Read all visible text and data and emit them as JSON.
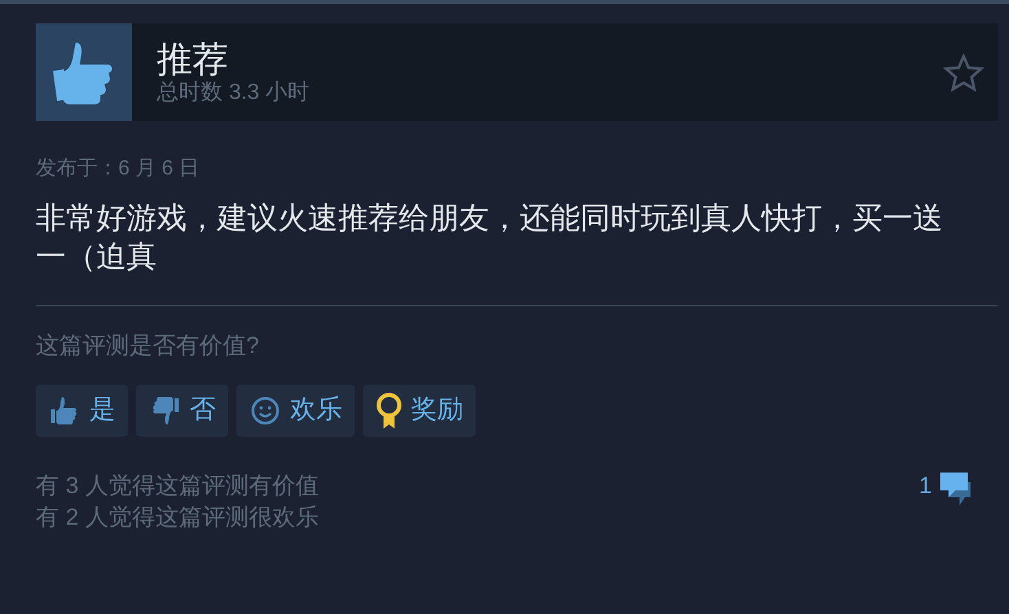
{
  "review": {
    "verdict": {
      "kind": "up",
      "label": "推荐"
    },
    "playtime": "总时数 3.3 小时",
    "favorited": false,
    "posted": "发布于：6 月 6 日",
    "body": "非常好游戏，建议火速推荐给朋友，还能同时玩到真人快打，买一送一（迫真"
  },
  "feedback": {
    "question": "这篇评测是否有价值?",
    "buttons": [
      {
        "kind": "yes",
        "label": "是"
      },
      {
        "kind": "no",
        "label": "否"
      },
      {
        "kind": "funny",
        "label": "欢乐"
      },
      {
        "kind": "award",
        "label": "奖励"
      }
    ]
  },
  "votes": [
    "有 3 人觉得这篇评测有价值",
    "有 2 人觉得这篇评测很欢乐"
  ],
  "comment_count": "1"
}
